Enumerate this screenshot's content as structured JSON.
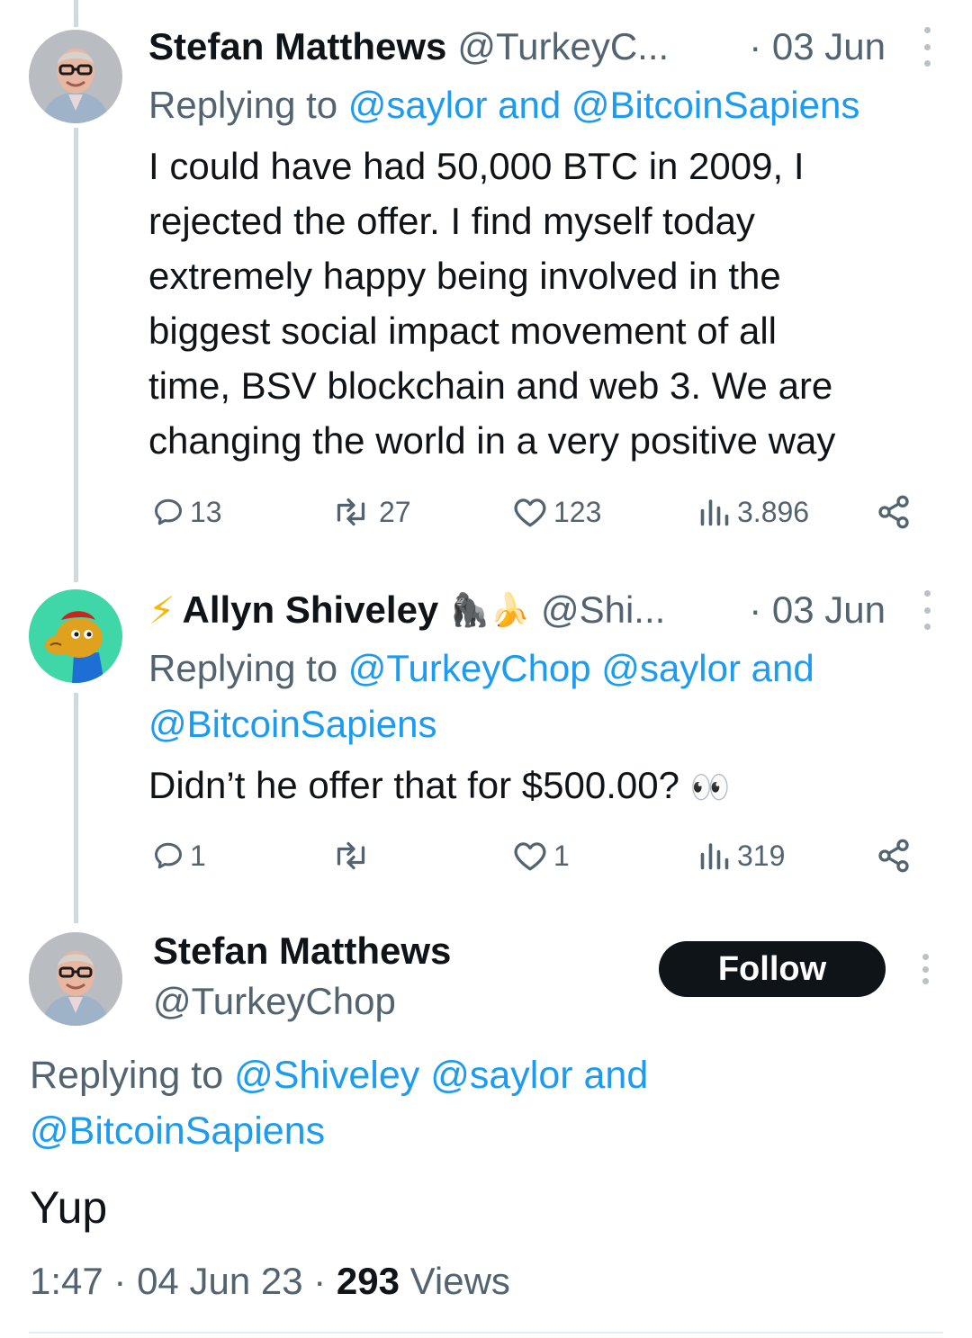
{
  "tweet1": {
    "name": "Stefan Matthews",
    "handle": "@TurkeyC...",
    "date": "· 03 Jun",
    "replying_prefix": "Replying to ",
    "replying_links": "@saylor and @BitcoinSapiens",
    "body_lines": [
      "I could have had 50,000 BTC in 2009, I",
      "rejected the offer. I find myself today",
      "extremely happy being involved in the",
      "biggest social impact movement of all",
      "time, BSV blockchain and web 3. We are",
      "changing the world in a very positive way"
    ],
    "replies": "13",
    "retweets": "27",
    "likes": "123",
    "views": "3.896"
  },
  "tweet2": {
    "lightning": "⚡",
    "name": "Allyn Shiveley",
    "emojis": "🦍🍌",
    "handle": "@Shi...",
    "date": "· 03 Jun",
    "replying_prefix": "Replying to ",
    "replying_line1_links": "@TurkeyChop @saylor and",
    "replying_line2_links": "@BitcoinSapiens",
    "body": "Didn’t he offer that for $500.00? ",
    "body_emoji": "👀",
    "replies": "1",
    "retweets": "",
    "likes": "1",
    "views": "319"
  },
  "tweet3": {
    "name": "Stefan Matthews",
    "handle": "@TurkeyChop",
    "follow_label": "Follow",
    "replying_prefix": "Replying to ",
    "replying_line1_links": "@Shiveley @saylor and",
    "replying_line2_links": "@BitcoinSapiens",
    "body": "Yup",
    "time": "1:47 · 04 Jun 23 · ",
    "views_count": "293",
    "views_label": " Views"
  },
  "colors": {
    "link": "#1d9bf0",
    "secondary": "#536471",
    "text": "#0f1419",
    "avatar2_bg": "#3fd6a8"
  }
}
